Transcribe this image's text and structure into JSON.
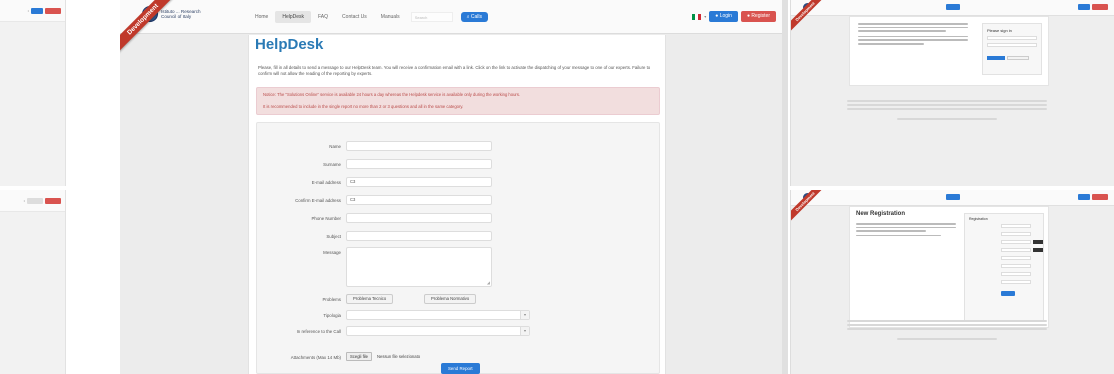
{
  "header": {
    "logo_text": "Istituto ... Research Council of Italy",
    "ribbon": "Development",
    "nav": [
      "Home",
      "HelpDesk",
      "FAQ",
      "Contact Us",
      "Manuals"
    ],
    "search_placeholder": "Search",
    "calls_label": "Calls",
    "login_label": "Login",
    "register_label": "Register"
  },
  "page": {
    "title": "HelpDesk",
    "intro": "Please, fill in all details to send a message to our HelpDesk team. You will receive a confirmation email with a link. Click on the link to activate the dispatching of your message to one of our experts. Failure to confirm will not allow the reading of the reporting by experts.",
    "alert_1": "Notice: The \"Solutions Online\" service is available 24 hours a day whereas the Helpdesk service is available only during the working hours.",
    "alert_2": "It is recommended to include in the single report no more than 2 or 3 questions and all in the same category."
  },
  "form": {
    "name_label": "Name",
    "surname_label": "Surname",
    "email_label": "E-mail address",
    "email_value": "C3",
    "confirm_email_label": "Confirm E-mail address",
    "confirm_email_value": "C3",
    "phone_label": "Phone Number",
    "subject_label": "Subject",
    "message_label": "Message",
    "problems_label": "Problems",
    "problem_tech": "Problema Tecnico",
    "problem_norm": "Problema Normativo",
    "typology_label": "Tipologia",
    "call_ref_label": "In reference to the Call",
    "attachments_label": "Attachments (Max 14 Mb)",
    "choose_file": "Scegli file",
    "no_file": "Nessun file selezionato",
    "send_label": "Send Report"
  },
  "thumb_right": {
    "login_title": "Please sign in",
    "registration_title": "New Registration",
    "registration_box_title": "Registration"
  },
  "colors": {
    "brand_blue": "#2a7ad6",
    "title_blue": "#2a7ab5",
    "danger": "#d9534f",
    "alert_bg": "#f2dede"
  }
}
